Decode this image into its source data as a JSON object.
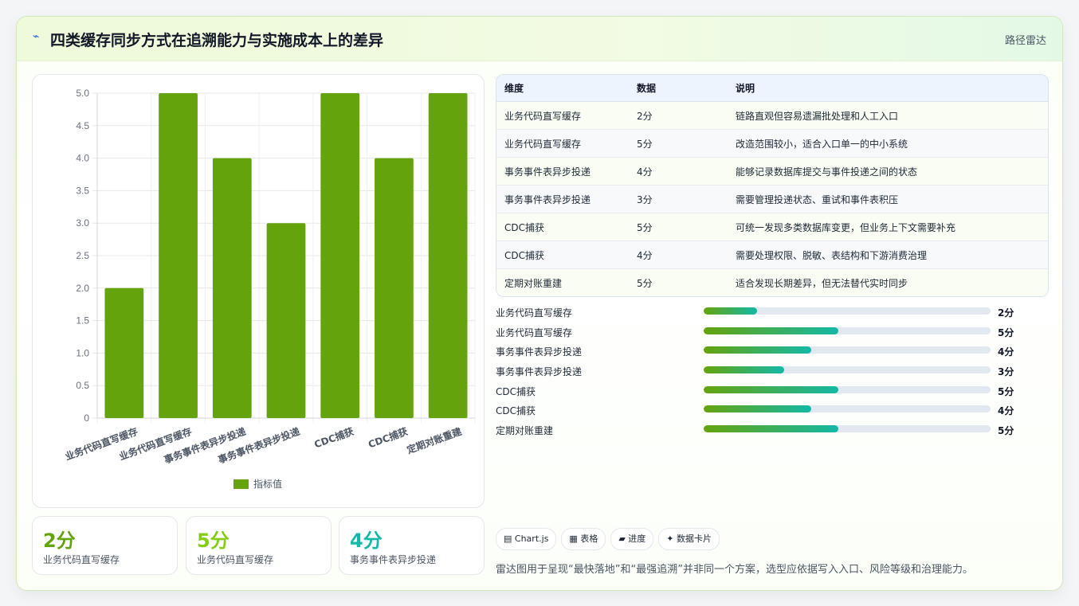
{
  "header": {
    "title": "四类缓存同步方式在追溯能力与实施成本上的差异",
    "nav_label": "路径雷达",
    "logo_icon": "lightning-icon"
  },
  "chart_data": {
    "type": "bar",
    "categories": [
      "业务代码直写缓存",
      "业务代码直写缓存",
      "事务事件表异步投递",
      "事务事件表异步投递",
      "CDC捕获",
      "CDC捕获",
      "定期对账重建"
    ],
    "series": [
      {
        "name": "指标值",
        "values": [
          2,
          5,
          4,
          3,
          5,
          4,
          5
        ],
        "color": "#65a30d"
      }
    ],
    "ylim": [
      0,
      5
    ],
    "yticks": [
      "0",
      "0.5",
      "1.0",
      "1.5",
      "2.0",
      "2.5",
      "3.0",
      "3.5",
      "4.0",
      "4.5",
      "5.0"
    ],
    "grid": true,
    "legend": "bottom"
  },
  "stats": [
    {
      "value": "2分",
      "label": "业务代码直写缓存",
      "color": "#65a30d"
    },
    {
      "value": "5分",
      "label": "业务代码直写缓存",
      "color": "#84cc16"
    },
    {
      "value": "4分",
      "label": "事务事件表异步投递",
      "color": "#14b8a6"
    }
  ],
  "table": {
    "headers": [
      "维度",
      "数据",
      "说明"
    ],
    "rows": [
      [
        "业务代码直写缓存",
        "2分",
        "链路直观但容易遗漏批处理和人工入口"
      ],
      [
        "业务代码直写缓存",
        "5分",
        "改造范围较小，适合入口单一的中小系统"
      ],
      [
        "事务事件表异步投递",
        "4分",
        "能够记录数据库提交与事件投递之间的状态"
      ],
      [
        "事务事件表异步投递",
        "3分",
        "需要管理投递状态、重试和事件表积压"
      ],
      [
        "CDC捕获",
        "5分",
        "可统一发现多类数据库变更，但业务上下文需要补充"
      ],
      [
        "CDC捕获",
        "4分",
        "需要处理权限、脱敏、表结构和下游消费治理"
      ],
      [
        "定期对账重建",
        "5分",
        "适合发现长期差异，但无法替代实时同步"
      ]
    ]
  },
  "progress": [
    {
      "label": "业务代码直写缓存",
      "value": "2分",
      "fraction": 0.185
    },
    {
      "label": "业务代码直写缓存",
      "value": "5分",
      "fraction": 0.47
    },
    {
      "label": "事务事件表异步投递",
      "value": "4分",
      "fraction": 0.375
    },
    {
      "label": "事务事件表异步投递",
      "value": "3分",
      "fraction": 0.28
    },
    {
      "label": "CDC捕获",
      "value": "5分",
      "fraction": 0.47
    },
    {
      "label": "CDC捕获",
      "value": "4分",
      "fraction": 0.375
    },
    {
      "label": "定期对账重建",
      "value": "5分",
      "fraction": 0.47
    }
  ],
  "tags": [
    {
      "icon": "chart-icon",
      "glyph": "▤",
      "label": "Chart.js"
    },
    {
      "icon": "table-icon",
      "glyph": "▦",
      "label": "表格"
    },
    {
      "icon": "progress-icon",
      "glyph": "▰",
      "label": "进度"
    },
    {
      "icon": "card-icon",
      "glyph": "✦",
      "label": "数据卡片"
    }
  ],
  "note": "雷达图用于呈现“最快落地”和“最强追溯”并非同一个方案，选型应依据写入入口、风险等级和治理能力。"
}
